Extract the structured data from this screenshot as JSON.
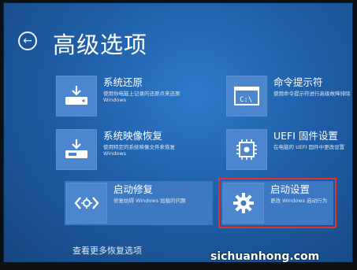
{
  "header": {
    "back_icon": "back-arrow-icon",
    "title": "高级选项"
  },
  "tiles": [
    {
      "icon": "restore-drive-icon",
      "title": "系统还原",
      "desc": "使用你电脑上记录的还原点来还原\nWindows"
    },
    {
      "icon": "command-prompt-icon",
      "title": "命令提示符",
      "desc": "使用命令提示符进行高级故障排除"
    },
    {
      "icon": "system-image-icon",
      "title": "系统映像恢复",
      "desc": "使用特定的系统映像文件来恢复\nWindows"
    },
    {
      "icon": "uefi-chip-icon",
      "title": "UEFI 固件设置",
      "desc": "在电脑的 UEFI 固件中更改设置"
    },
    {
      "icon": "startup-repair-icon",
      "title": "启动修复",
      "desc": "修复妨碍 Windows 加载的问题"
    },
    {
      "icon": "gear-icon",
      "title": "启动设置",
      "desc": "更改 Windows 启动行为"
    }
  ],
  "footer": {
    "more_options": "查看更多恢复选项"
  },
  "watermark": "sichuanhong.com",
  "colors": {
    "background": "#1f5fa8",
    "tile_icon_bg": "#4b86cf",
    "highlight_border": "#e0322f"
  }
}
